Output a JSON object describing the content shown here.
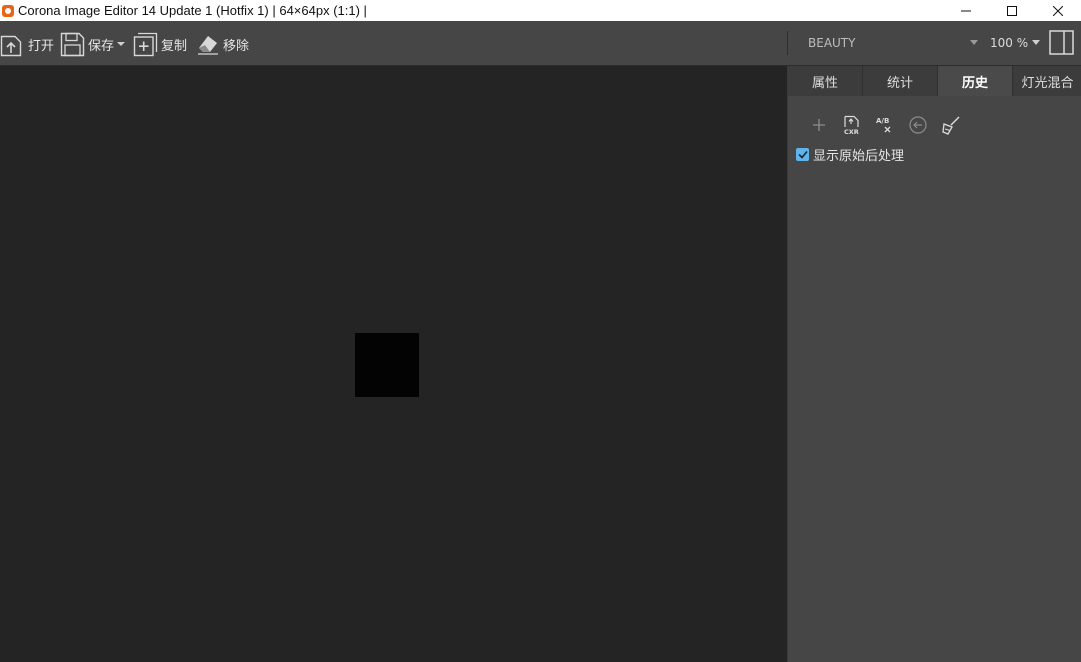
{
  "window": {
    "title": "Corona Image Editor 14 Update 1 (Hotfix 1) | 64×64px (1:1) |"
  },
  "toolbar": {
    "open_label": "打开",
    "save_label": "保存",
    "copy_label": "复制",
    "remove_label": "移除",
    "render_element": "BEAUTY",
    "zoom": "100 %"
  },
  "panel": {
    "tabs": [
      {
        "label": "属性"
      },
      {
        "label": "统计"
      },
      {
        "label": "历史"
      },
      {
        "label": "灯光混合"
      }
    ],
    "active_tab": "历史",
    "history_tools": [
      "add-icon",
      "load-cxr-icon",
      "ab-compare-icon",
      "restore-icon",
      "clear-history-icon"
    ],
    "show_original_checkbox": {
      "label": "显示原始后处理",
      "checked": true
    }
  },
  "colors": {
    "accent": "#5fb4ec",
    "toolbar_bg": "#464646",
    "viewport_bg": "#242424",
    "image_fill": "#030303"
  }
}
